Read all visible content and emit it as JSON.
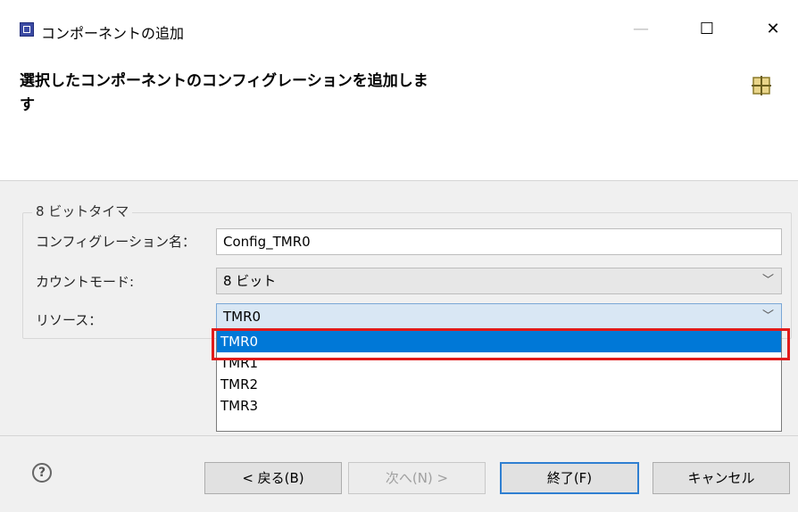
{
  "window": {
    "title": "コンポーネントの追加",
    "minimize_glyph": "—",
    "maximize_glyph": "☐",
    "close_glyph": "✕"
  },
  "header": {
    "title": "選択したコンポーネントのコンフィグレーションを追加します",
    "icon": "component-grid-icon"
  },
  "group": {
    "label": "8 ビットタイマ",
    "fields": [
      {
        "label": "コンフィグレーション名：",
        "value": "Config_TMR0"
      },
      {
        "label": "カウントモード:",
        "value": "8 ビット"
      },
      {
        "label": "リソース：",
        "value": "TMR0"
      }
    ]
  },
  "dropdown": {
    "options": [
      "TMR0",
      "TMR1",
      "TMR2",
      "TMR3"
    ],
    "selected": "TMR0",
    "highlight_color": "#e01b1b"
  },
  "footer": {
    "help_glyph": "?",
    "back_label": "< 戻る(B)",
    "next_label": "次へ(N) >",
    "finish_label": "終了(F)",
    "cancel_label": "キャンセル"
  },
  "colors": {
    "selection": "#0078d7",
    "dialog_bg": "#f0f0f0"
  }
}
